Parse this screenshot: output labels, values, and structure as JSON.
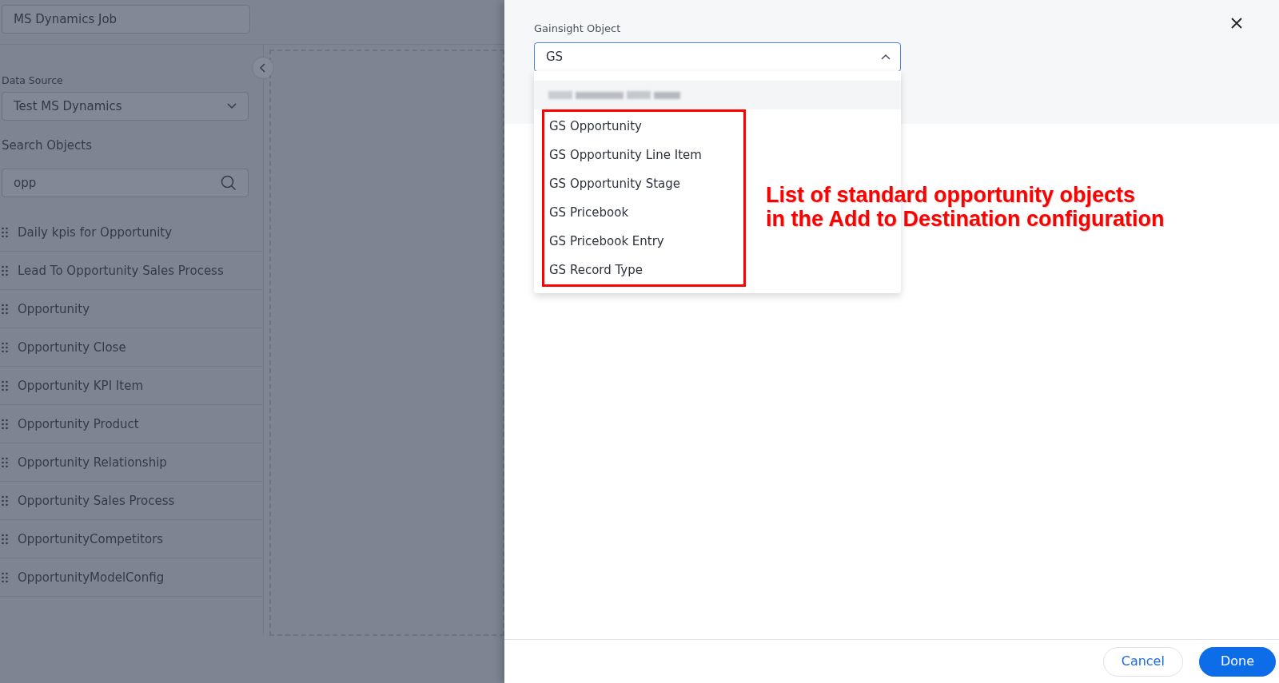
{
  "job_name": "MS Dynamics Job",
  "data_source": {
    "label": "Data Source",
    "value": "Test MS Dynamics"
  },
  "search": {
    "label": "Search Objects",
    "value": "opp"
  },
  "objects": [
    "Daily kpis for Opportunity",
    "Lead To Opportunity Sales Process",
    "Opportunity",
    "Opportunity Close",
    "Opportunity KPI Item",
    "Opportunity Product",
    "Opportunity Relationship",
    "Opportunity Sales Process",
    "OpportunityCompetitors",
    "OpportunityModelConfig"
  ],
  "drawer": {
    "field_label": "Gainsight Object",
    "field_value": "GS",
    "expanded": true,
    "options": [
      "GS Opportunity",
      "GS Opportunity Line Item",
      "GS Opportunity Stage",
      "GS Pricebook",
      "GS Pricebook Entry",
      "GS Record Type"
    ]
  },
  "annotation": [
    "List of standard opportunity objects",
    "in the Add to Destination configuration"
  ],
  "buttons": [
    {
      "label": "Cancel",
      "kind": "secondary"
    },
    {
      "label": "Done",
      "kind": "primary"
    }
  ]
}
